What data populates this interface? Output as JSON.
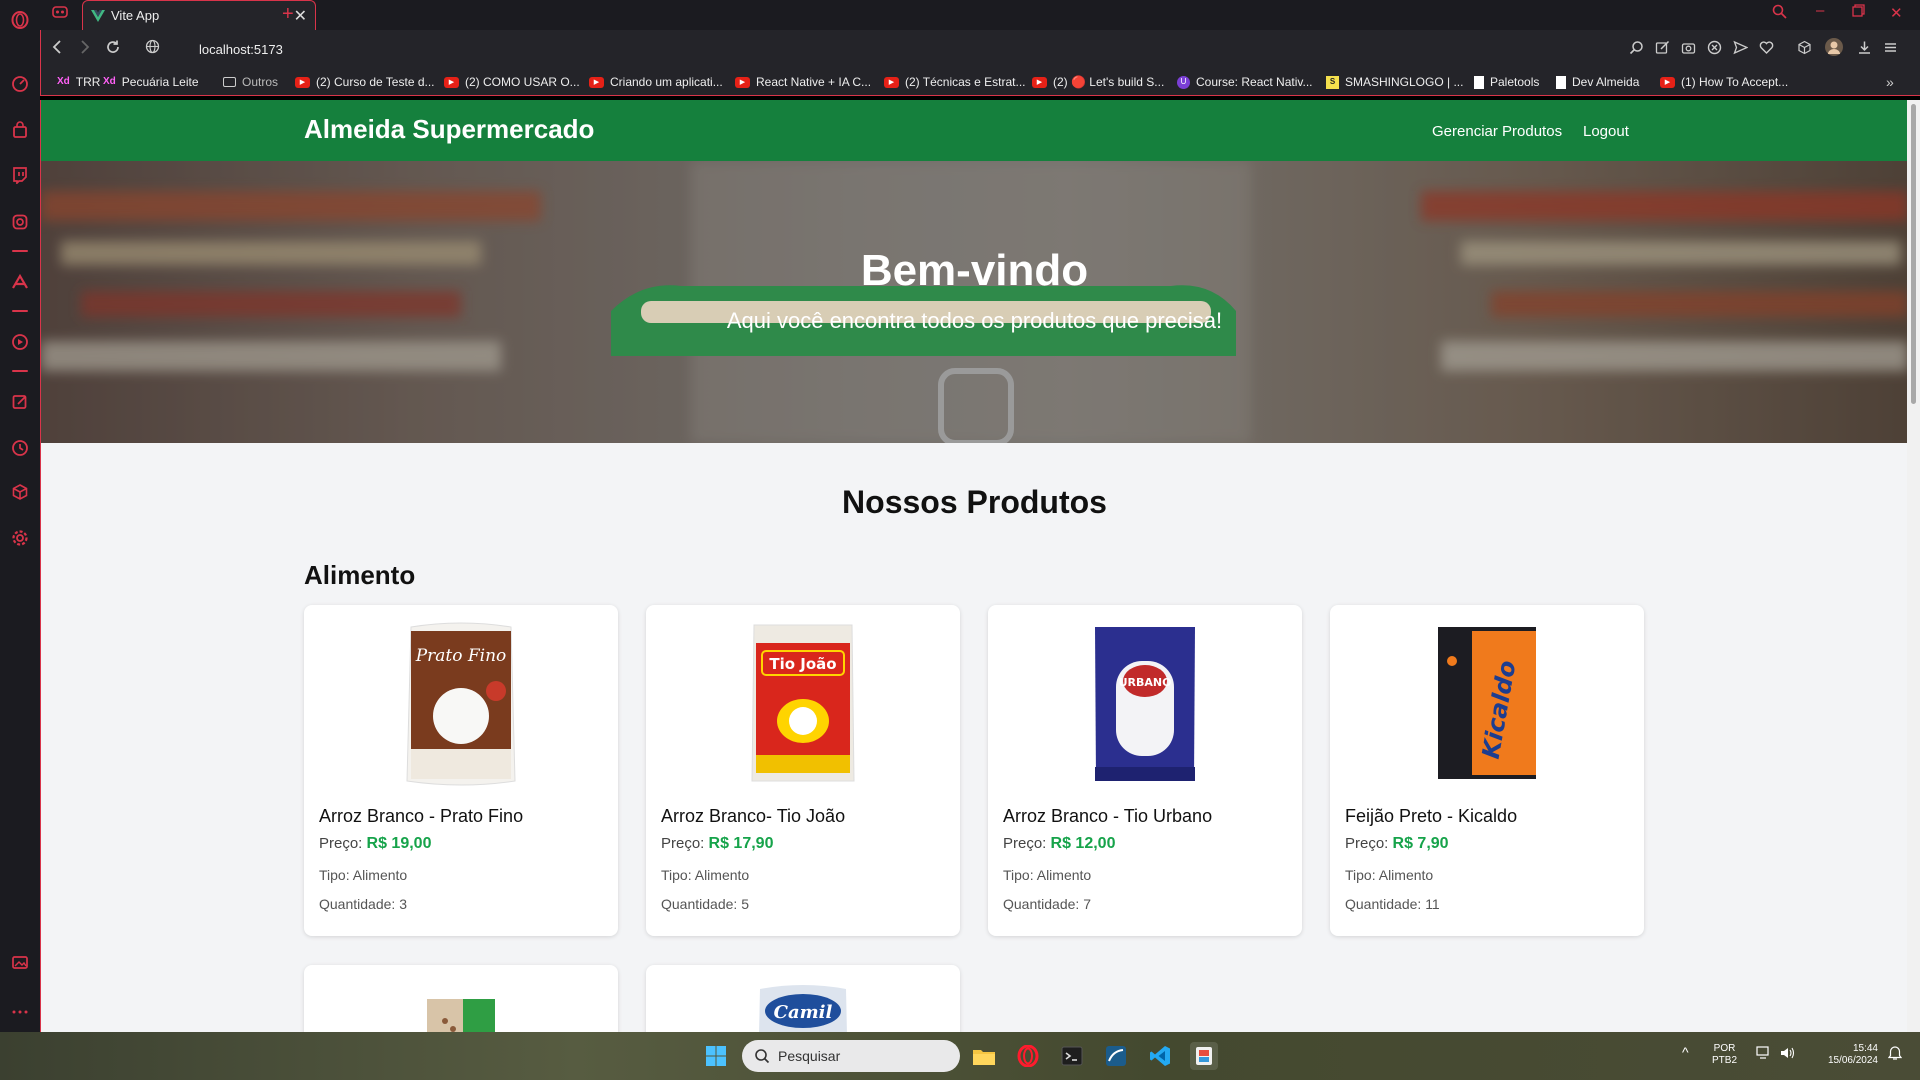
{
  "browser": {
    "tab_title": "Vite App",
    "url": "localhost:5173",
    "bookmarks": [
      {
        "label": "TRR",
        "icon": "xd-icon"
      },
      {
        "label": "Pecuária Leite",
        "icon": "xd-icon"
      },
      {
        "label": "Outros",
        "icon": "folder-icon"
      },
      {
        "label": "(2) Curso de Teste d...",
        "icon": "youtube-icon"
      },
      {
        "label": "(2) COMO USAR O...",
        "icon": "youtube-icon"
      },
      {
        "label": "Criando um aplicati...",
        "icon": "youtube-icon"
      },
      {
        "label": "React Native + IA C...",
        "icon": "youtube-icon"
      },
      {
        "label": "(2) Técnicas e Estrat...",
        "icon": "youtube-icon"
      },
      {
        "label": "(2) 🔴 Let's build S...",
        "icon": "youtube-icon"
      },
      {
        "label": "Course: React Nativ...",
        "icon": "course-icon"
      },
      {
        "label": "SMASHINGLOGO | ...",
        "icon": "smashinglogo-icon"
      },
      {
        "label": "Paletools",
        "icon": "document-icon"
      },
      {
        "label": "Dev Almeida",
        "icon": "document-icon"
      },
      {
        "label": "(1) How To Accept...",
        "icon": "youtube-icon"
      }
    ]
  },
  "site": {
    "brand": "Almeida Supermercado",
    "nav": {
      "manage": "Gerenciar Produtos",
      "logout": "Logout"
    },
    "hero": {
      "title": "Bem-vindo",
      "subtitle": "Aqui você encontra todos os produtos que precisa!"
    },
    "section_title": "Nossos Produtos",
    "category": "Alimento",
    "labels": {
      "price": "Preço:",
      "type": "Tipo:",
      "quantity": "Quantidade:"
    },
    "products": [
      {
        "name": "Arroz Branco - Prato Fino",
        "price": "R$ 19,00",
        "type": "Alimento",
        "quantity": "3",
        "package_text": "Prato Fino",
        "package_color": "#7a3b1e"
      },
      {
        "name": "Arroz Branco- Tio João",
        "price": "R$ 17,90",
        "type": "Alimento",
        "quantity": "5",
        "package_text": "Tio João",
        "package_color": "#d9261c"
      },
      {
        "name": "Arroz Branco - Tio Urbano",
        "price": "R$ 12,00",
        "type": "Alimento",
        "quantity": "7",
        "package_text": "URBANO",
        "package_color": "#2b2f8f"
      },
      {
        "name": "Feijão Preto - Kicaldo",
        "price": "R$ 7,90",
        "type": "Alimento",
        "quantity": "11",
        "package_text": "Kicaldo",
        "package_color": "#f07a1c"
      },
      {
        "name": "",
        "price": "",
        "type": "",
        "quantity": "",
        "package_text": "",
        "package_color": "#2f9e44"
      },
      {
        "name": "",
        "price": "",
        "type": "",
        "quantity": "",
        "package_text": "Camil",
        "package_color": "#1f4e9c"
      }
    ]
  },
  "taskbar": {
    "search_placeholder": "Pesquisar",
    "lang_top": "POR",
    "lang_bottom": "PTB2",
    "time": "15:44",
    "date": "15/06/2024"
  },
  "colors": {
    "accent": "#d9344a",
    "brand_green": "#15803d",
    "price_green": "#16a34a"
  }
}
